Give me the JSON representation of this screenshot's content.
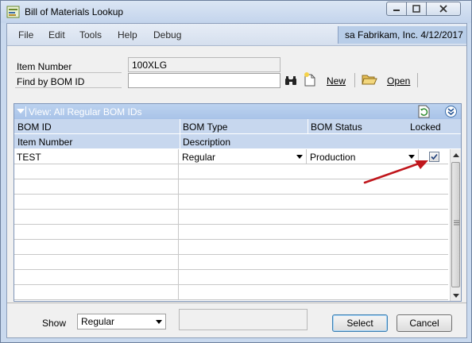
{
  "window": {
    "title": "Bill of Materials Lookup",
    "icon": "app-window-icon"
  },
  "menu": {
    "items": [
      "File",
      "Edit",
      "Tools",
      "Help",
      "Debug"
    ],
    "company_status": "sa  Fabrikam, Inc.  4/12/2017"
  },
  "header": {
    "item_number_label": "Item Number",
    "item_number_value": "100XLG",
    "find_by_label": "Find by BOM ID",
    "find_by_value": "",
    "new_label": "New",
    "open_label": "Open"
  },
  "grid": {
    "view_label": "View: All Regular BOM IDs",
    "columns_row1": [
      "BOM ID",
      "BOM Type",
      "BOM Status",
      "Locked"
    ],
    "columns_row2": [
      "Item Number",
      "Description"
    ],
    "rows": [
      {
        "bom_id": "TEST",
        "bom_type": "Regular",
        "bom_status": "Production",
        "locked": true
      }
    ],
    "empty_rows": 9
  },
  "footer": {
    "show_label": "Show",
    "show_value": "Regular",
    "select_label": "Select",
    "cancel_label": "Cancel"
  },
  "colors": {
    "accent": "#c9d9ee",
    "grid_header": "#c7d7ee",
    "annotation_arrow": "#c0161c"
  }
}
